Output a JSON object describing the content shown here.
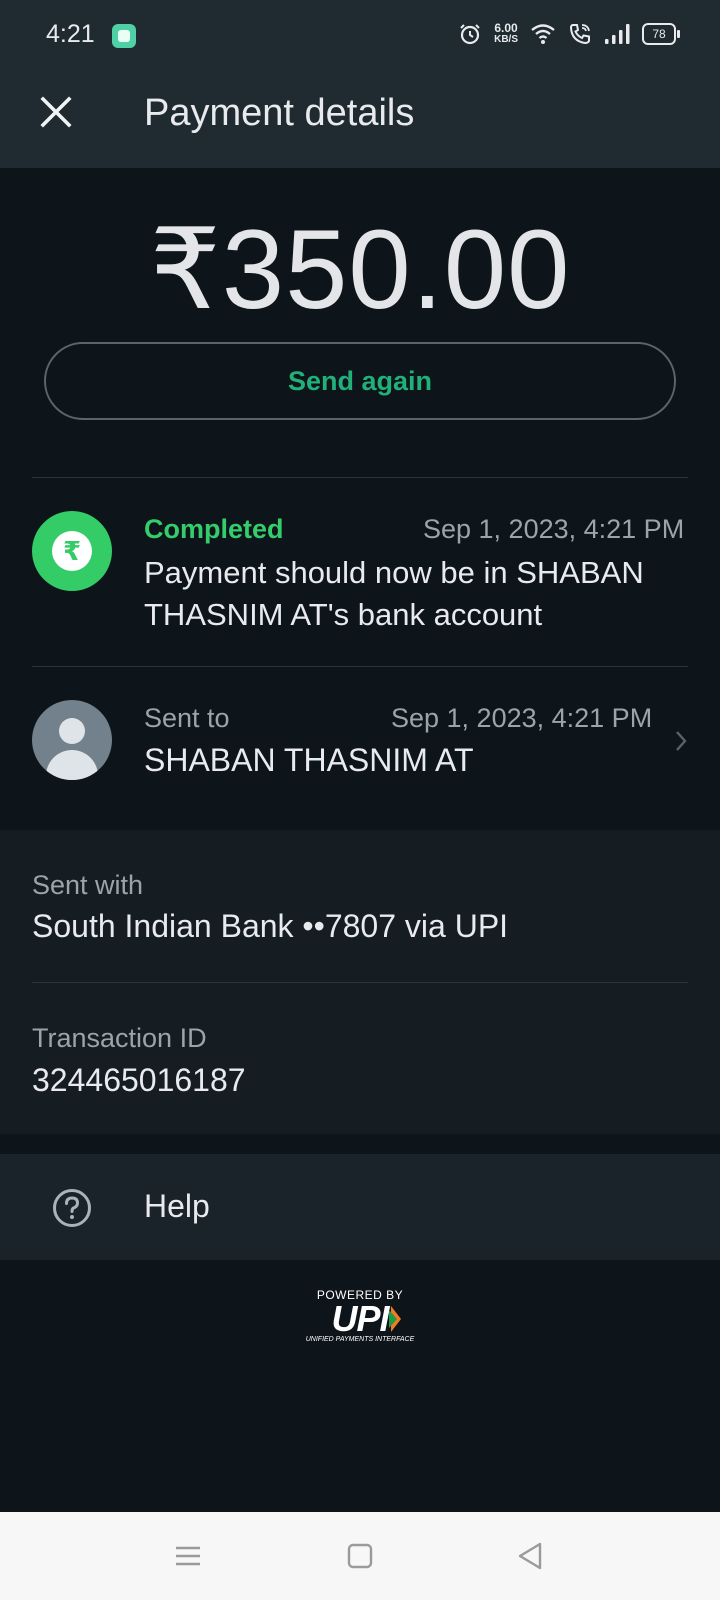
{
  "status_bar": {
    "time": "4:21",
    "speed_value": "6.00",
    "speed_unit": "KB/S",
    "battery": "78",
    "icons": [
      "app-notification-icon",
      "alarm-icon",
      "wifi-icon",
      "wifi-calling-icon",
      "signal-icon",
      "battery-icon"
    ]
  },
  "header": {
    "title": "Payment details",
    "close_icon": "close-icon"
  },
  "payment": {
    "amount": "₹350.00",
    "send_again_label": "Send again"
  },
  "status": {
    "label": "Completed",
    "timestamp": "Sep 1, 2023, 4:21 PM",
    "message": "Payment should now be in SHABAN THASNIM AT's bank account",
    "icon": "rupee-icon",
    "color": "#35cc6c"
  },
  "recipient": {
    "label": "Sent to",
    "timestamp": "Sep 1, 2023, 4:21 PM",
    "name": "SHABAN THASNIM AT"
  },
  "details": {
    "sent_with_label": "Sent with",
    "sent_with_value": "South Indian Bank ••7807 via UPI",
    "transaction_id_label": "Transaction ID",
    "transaction_id_value": "324465016187"
  },
  "help": {
    "label": "Help",
    "icon": "help-icon"
  },
  "footer": {
    "powered_by": "POWERED BY",
    "logo_text": "UPI",
    "logo_subtext": "UNIFIED PAYMENTS INTERFACE"
  },
  "colors": {
    "accent_green": "#22b07a",
    "completed_green": "#33cc66",
    "background": "#0d141a",
    "app_bar": "#1f2a31"
  }
}
